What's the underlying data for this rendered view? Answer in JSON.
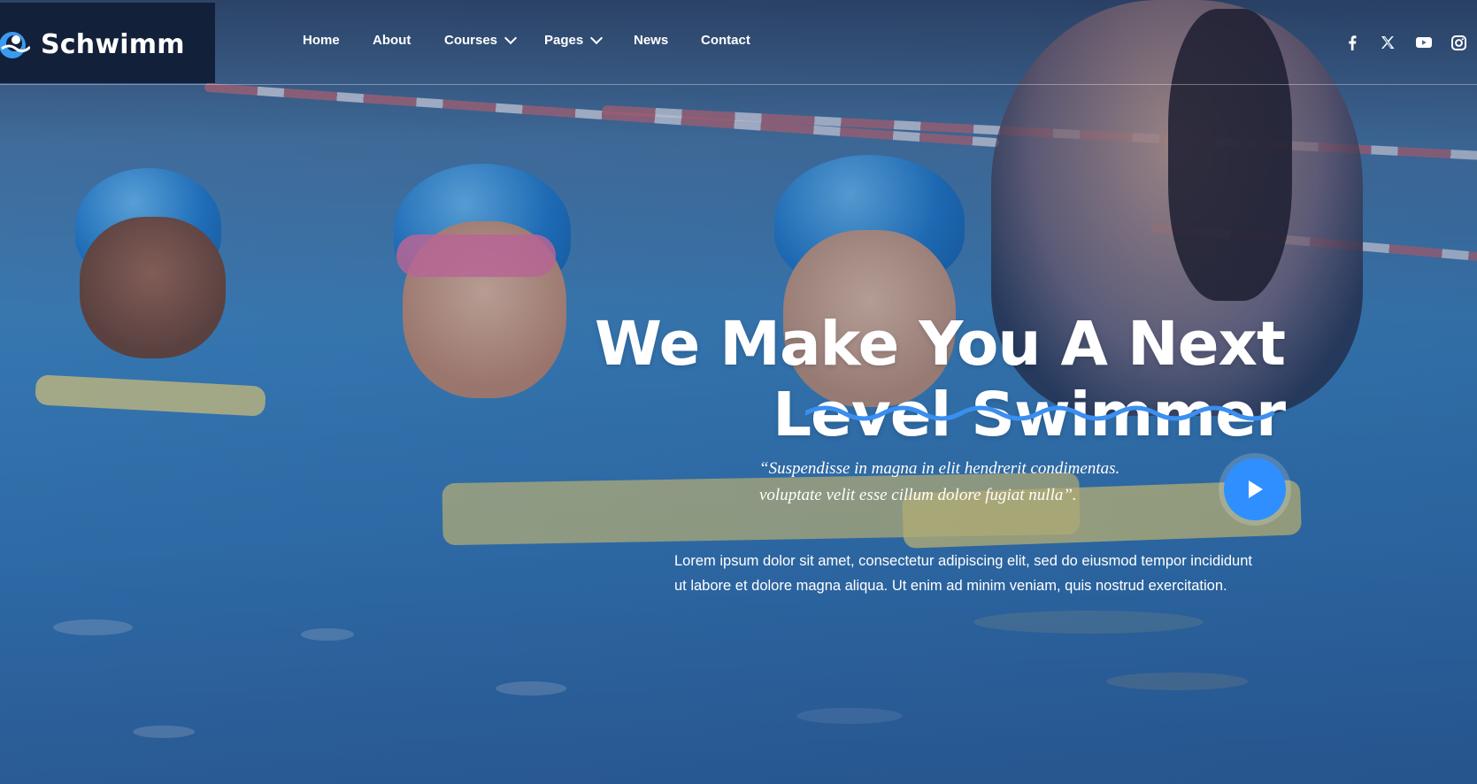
{
  "brand": {
    "name": "Schwimm",
    "logo_icon": "swim-wave-logo-icon"
  },
  "nav": {
    "items": [
      {
        "label": "Home",
        "has_dropdown": false
      },
      {
        "label": "About",
        "has_dropdown": false
      },
      {
        "label": "Courses",
        "has_dropdown": true
      },
      {
        "label": "Pages",
        "has_dropdown": true
      },
      {
        "label": "News",
        "has_dropdown": false
      },
      {
        "label": "Contact",
        "has_dropdown": false
      }
    ]
  },
  "social": [
    {
      "icon": "facebook-icon"
    },
    {
      "icon": "x-twitter-icon"
    },
    {
      "icon": "youtube-icon"
    },
    {
      "icon": "instagram-icon"
    }
  ],
  "hero": {
    "headline_line1": "We Make You A Next",
    "headline_line2": "Level Swimmer",
    "quote_line1": "“Suspendisse in magna in elit hendrerit condimentas.",
    "quote_line2": "voluptate velit esse cillum dolore fugiat nulla”.",
    "lead_line1": "Lorem ipsum dolor sit amet, consectetur adipiscing elit, sed do eiusmod tempor incididunt",
    "lead_line2": "ut labore et dolore magna aliqua. Ut enim ad minim veniam, quis nostrud exercitation.",
    "play_icon": "play-icon"
  },
  "colors": {
    "brand_bg": "#13203a",
    "accent": "#2f8fff",
    "wave": "#3a8ff0"
  }
}
